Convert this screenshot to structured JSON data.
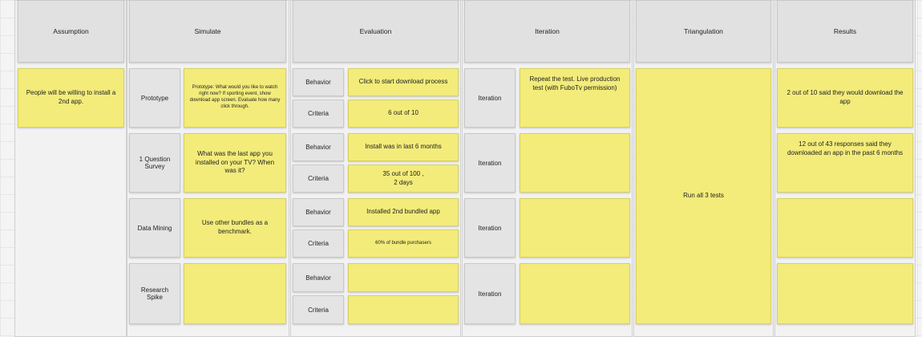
{
  "headers": {
    "assumption": "Assumption",
    "simulate": "Simulate",
    "evaluation": "Evaluation",
    "iteration": "Iteration",
    "triangulation": "Triangulation",
    "results": "Results"
  },
  "assumption": "People will be willing to install a 2nd app.",
  "rows": [
    {
      "method": "Prototype",
      "simulate": "Prototype: What would you like to watch right now? If sporting event, show download app screen. Evaluate how many click through.",
      "behavior_label": "Behavior",
      "behavior": "Click to start download process",
      "criteria_label": "Criteria",
      "criteria": "6 out of 10",
      "iteration_label": "Iteration",
      "iteration": "Repeat the test. Live production test (with FuboTv permission)",
      "result": "2 out of 10 said they would download the app"
    },
    {
      "method": "1 Question Survey",
      "simulate": "What was the last app you installed on your TV? When was it?",
      "behavior_label": "Behavior",
      "behavior": "Install was in last 6 months",
      "criteria_label": "Criteria",
      "criteria": "35 out of 100 , 2 days",
      "iteration_label": "Iteration",
      "iteration": "",
      "result": "12 out of 43 responses said they downloaded an app in the past 6 months"
    },
    {
      "method": "Data Mining",
      "simulate": "Use other bundles as a benchmark.",
      "behavior_label": "Behavior",
      "behavior": "Installed 2nd bundled app",
      "criteria_label": "Criteria",
      "criteria": "60% of bundle purchasers",
      "iteration_label": "Iteration",
      "iteration": "",
      "result": ""
    },
    {
      "method": "Research Spike",
      "simulate": "",
      "behavior_label": "Behavior",
      "behavior": "",
      "criteria_label": "Criteria",
      "criteria": "",
      "iteration_label": "Iteration",
      "iteration": "",
      "result": ""
    }
  ],
  "triangulation": "Run all 3 tests"
}
